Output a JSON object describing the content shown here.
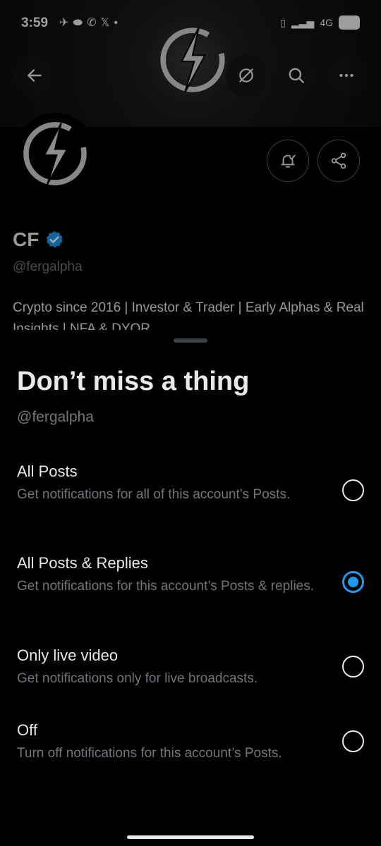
{
  "status_bar": {
    "time": "3:59",
    "left_icons": [
      "telegram-icon",
      "pill-icon",
      "whatsapp-icon",
      "x-icon",
      "dot-icon"
    ],
    "network": "4G",
    "battery": "69"
  },
  "profile": {
    "name": "CF",
    "handle": "@fergalpha",
    "bio": "Crypto since 2016 | Investor & Trader | Early Alphas & Real Insights | NFA & DYOR"
  },
  "sheet": {
    "title": "Don’t miss a thing",
    "subtitle": "@fergalpha",
    "options": [
      {
        "title": "All Posts",
        "description": "Get notifications for all of this account’s Posts.",
        "selected": false
      },
      {
        "title": "All Posts & Replies",
        "description": "Get notifications for this account’s Posts & replies.",
        "selected": true
      },
      {
        "title": "Only live video",
        "description": "Get notifications only for live broadcasts.",
        "selected": false
      },
      {
        "title": "Off",
        "description": "Turn off notifications for this account’s Posts.",
        "selected": false
      }
    ]
  },
  "colors": {
    "accent": "#1d9bf0",
    "background": "#000000",
    "text_primary": "#e7e9ea",
    "text_secondary": "#71767b"
  }
}
